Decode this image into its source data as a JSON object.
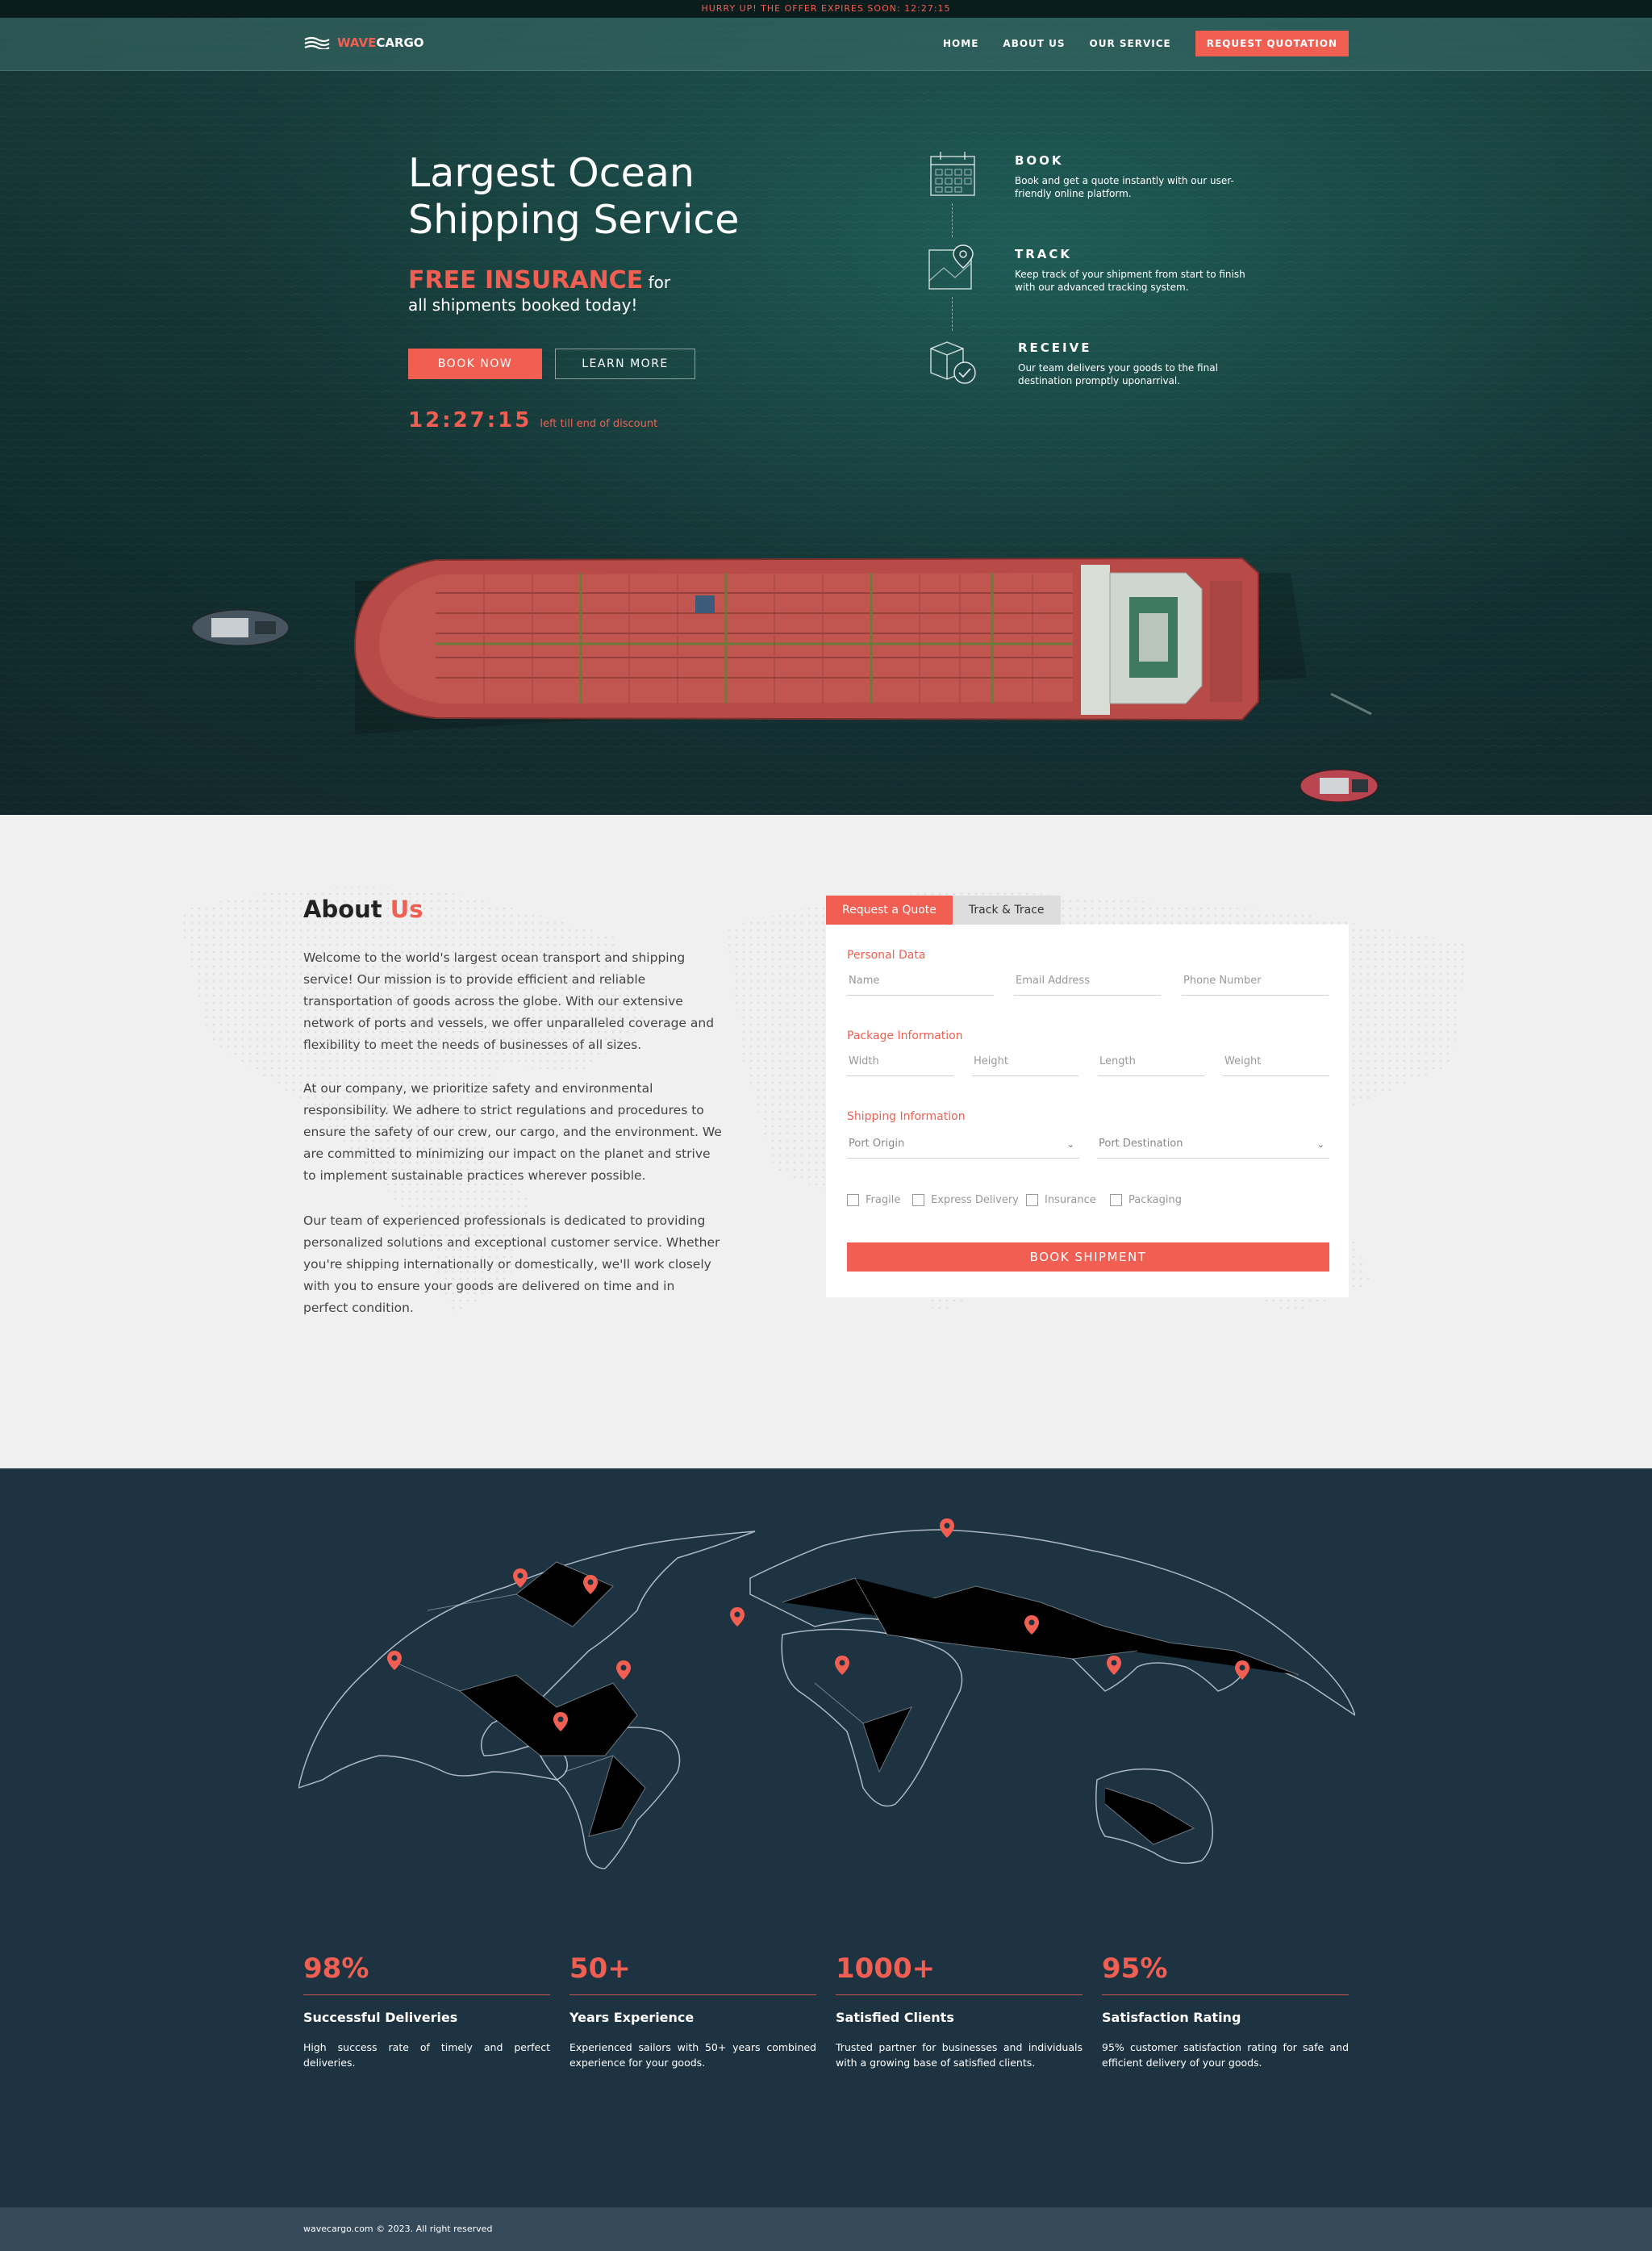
{
  "promo": {
    "text": "HURRY UP! THE OFFER EXPIRES SOON: 12:27:15"
  },
  "brand": {
    "wave": "WAVE",
    "cargo": "CARGO",
    "accent": "#f05f52"
  },
  "nav": {
    "links": [
      "HOME",
      "ABOUT US",
      "OUR SERVICE"
    ],
    "cta": "REQUEST QUOTATION"
  },
  "hero": {
    "title": "Largest Ocean Shipping Service",
    "highlight": "FREE INSURANCE",
    "highlight_tail": "for",
    "sub_line2": "all shipments booked today!",
    "book_button": "BOOK NOW",
    "learn_button": "LEARN MORE",
    "countdown": "12:27:15",
    "countdown_label": "left till end of discount"
  },
  "steps": [
    {
      "icon": "calendar-icon",
      "title": "BOOK",
      "desc": "Book and get a quote instantly with our user-friendly online platform."
    },
    {
      "icon": "map-pin-icon",
      "title": "TRACK",
      "desc": "Keep track of your shipment from start to finish with our advanced tracking system."
    },
    {
      "icon": "package-check-icon",
      "title": "RECEIVE",
      "desc": "Our team delivers your goods to the final destination promptly uponarrival."
    }
  ],
  "about": {
    "title_a": "About",
    "title_b": "Us",
    "paragraphs": [
      "Welcome to the world's largest ocean transport and shipping service! Our mission is to provide efficient and reliable transportation of goods across the globe. With our extensive network of ports and vessels, we offer unparalleled coverage and flexibility to meet the needs of businesses of all sizes.",
      "At our company, we prioritize safety and environmental responsibility. We adhere to strict regulations and procedures to ensure the safety of our crew, our cargo, and the environment. We are committed to minimizing our impact on the planet and strive to implement sustainable practices wherever possible.",
      "Our team of experienced professionals is dedicated to providing personalized solutions and exceptional customer service. Whether you're shipping internationally or domestically, we'll work closely with you to ensure your goods are delivered on time and in perfect condition."
    ]
  },
  "form": {
    "tabs": [
      "Request a Quote",
      "Track & Trace"
    ],
    "personal_label": "Personal Data",
    "personal_fields": [
      "Name",
      "Email Address",
      "Phone Number"
    ],
    "package_label": "Package Information",
    "package_fields": [
      "Width",
      "Height",
      "Length",
      "Weight"
    ],
    "shipping_label": "Shipping Information",
    "origin": "Port Origin",
    "destination": "Port Destination",
    "options": [
      "Fragile",
      "Express Delivery",
      "Insurance",
      "Packaging"
    ],
    "submit": "BOOK SHIPMENT"
  },
  "stats": [
    {
      "value": "98%",
      "title": "Successful Deliveries",
      "desc": "High success rate of timely and perfect deliveries."
    },
    {
      "value": "50+",
      "title": "Years Experience",
      "desc": "Experienced sailors with 50+ years combined experience for your goods."
    },
    {
      "value": "1000+",
      "title": "Satisfied Clients",
      "desc": "Trusted partner for businesses and individuals with a growing base of satisfied clients."
    },
    {
      "value": "95%",
      "title": "Satisfaction Rating",
      "desc": "95% customer satisfaction rating for safe and efficient delivery of your goods."
    }
  ],
  "footer": {
    "text": "wavecargo.com © 2023. All right reserved"
  }
}
